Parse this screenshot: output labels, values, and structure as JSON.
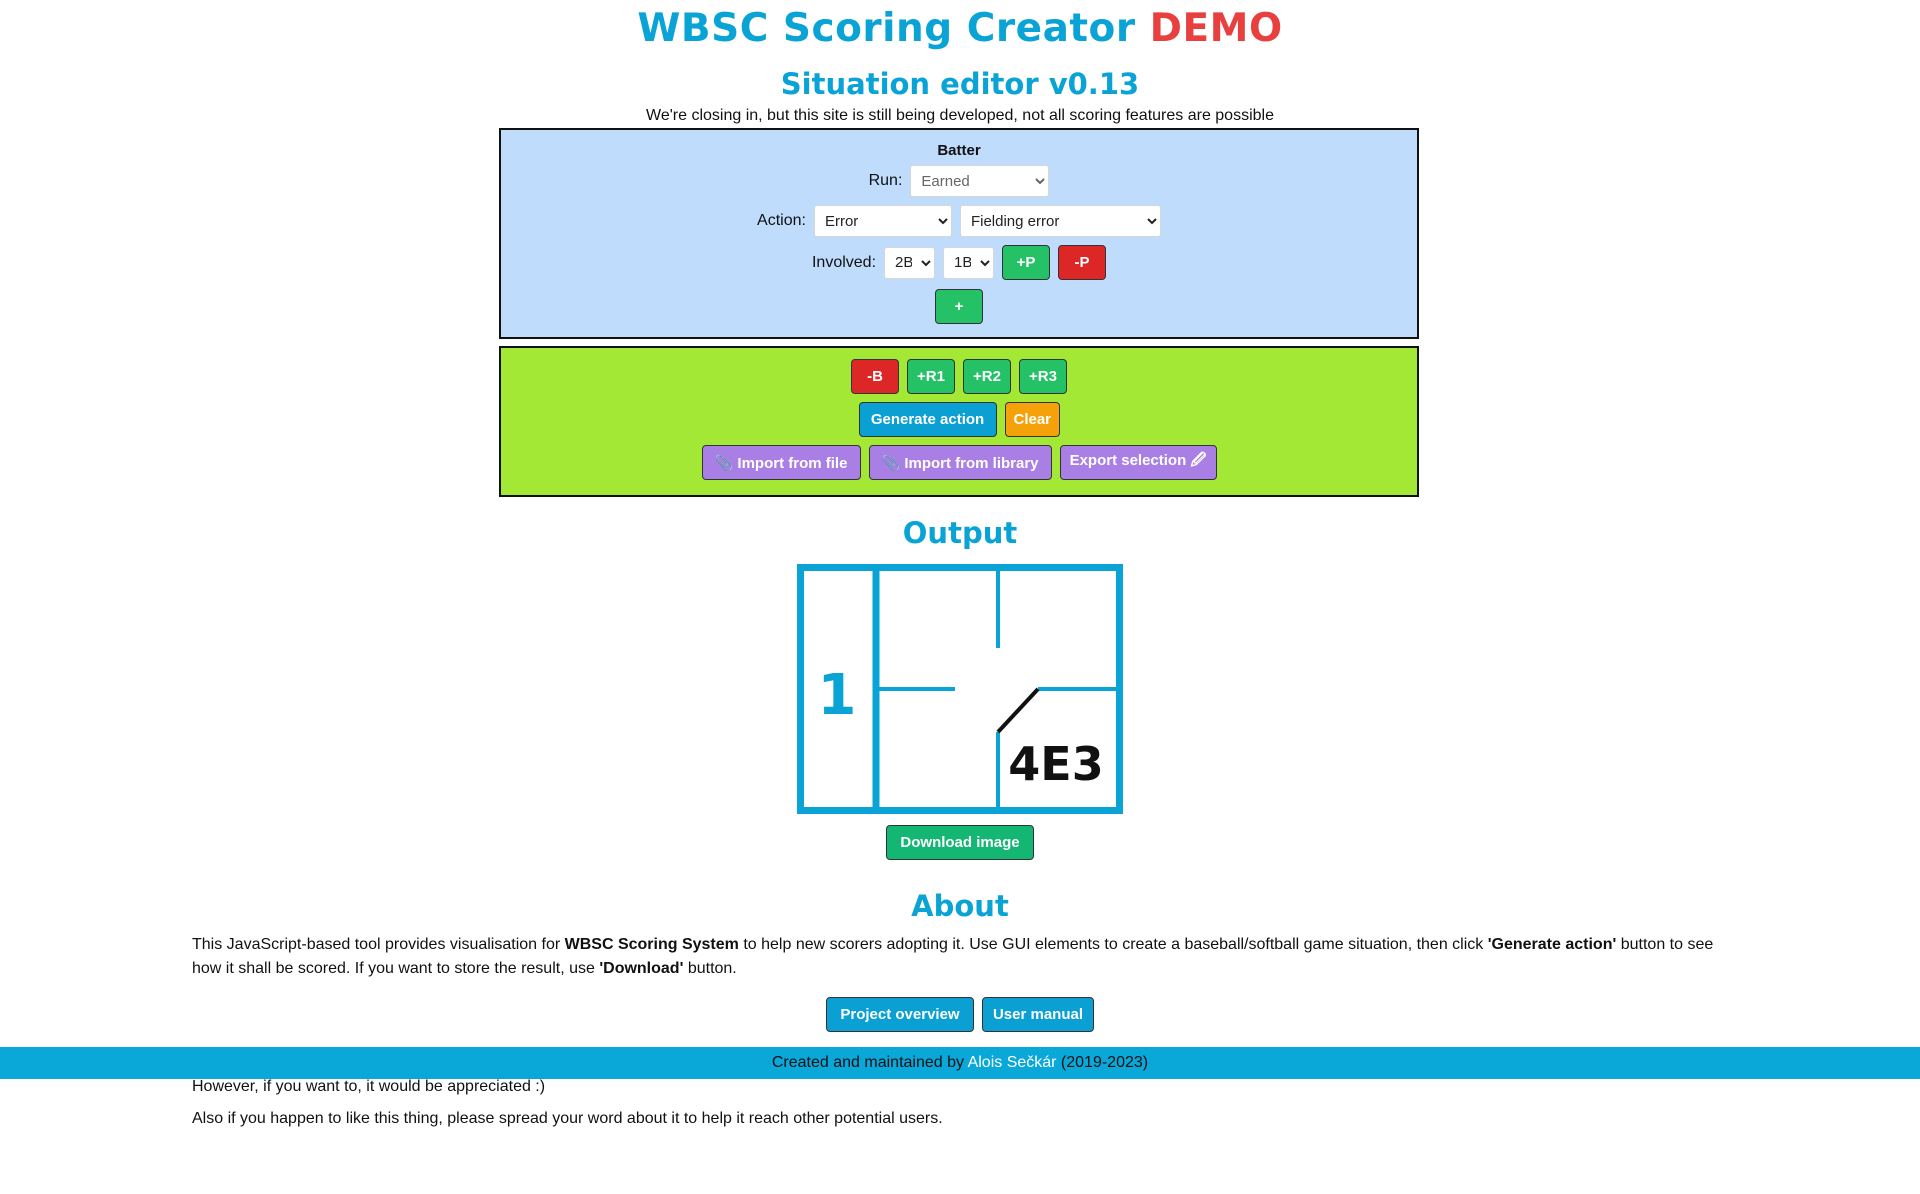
{
  "header": {
    "title": "WBSC Scoring Creator",
    "title_badge": "DEMO",
    "subtitle": "Situation editor v0.13",
    "notice": "We're closing in, but this site is still being developed, not all scoring features are possible"
  },
  "batter_panel": {
    "heading": "Batter",
    "run_label": "Run:",
    "run_value": "Earned",
    "action_label": "Action:",
    "action_value": "Error",
    "action_detail_value": "Fielding error",
    "involved_label": "Involved:",
    "involved_1": "2B",
    "involved_2": "1B",
    "add_player": "+P",
    "remove_player": "-P",
    "add_action": "+"
  },
  "control_panel": {
    "remove_batter": "-B",
    "add_runner_1": "+R1",
    "add_runner_2": "+R2",
    "add_runner_3": "+R3",
    "generate": "Generate action",
    "clear": "Clear",
    "import_file": "📎 Import from file",
    "import_library": "📎 Import from library",
    "export_selection": "Export selection 🖉"
  },
  "output": {
    "heading": "Output",
    "batter_number": "1",
    "play_code": "4E3",
    "download": "Download image",
    "frame_color": "#0aa3d6"
  },
  "about": {
    "heading": "About",
    "text_1": "This JavaScript-based tool provides visualisation for ",
    "text_bold_1": "WBSC Scoring System",
    "text_2": " to help new scorers adopting it. Use GUI elements to create a baseball/softball game situation, then click ",
    "text_bold_2": "'Generate action'",
    "text_3": " button to see how it shall be scored. If you want to store the result, use ",
    "text_bold_3": "'Download'",
    "text_4": " button.",
    "project_overview": "Project overview",
    "user_manual": "User manual"
  },
  "footer": {
    "prefix": "Created and maintained by ",
    "author": "Alois Sečkár",
    "suffix": " (2019-2023)"
  },
  "after_footer": {
    "line_1": "However, if you want to, it would be appreciated :)",
    "line_2": "Also if you happen to like this thing, please spread your word about it to help it reach other potential users."
  }
}
